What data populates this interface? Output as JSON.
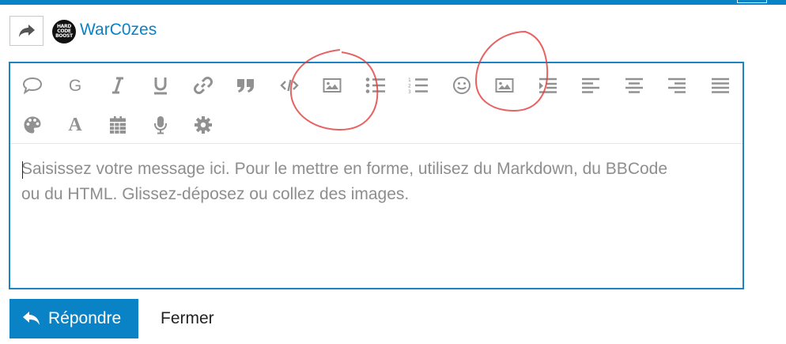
{
  "user": {
    "name": "WarC0zes",
    "avatar_lines": [
      "HARD",
      "CODE",
      "BOOST"
    ]
  },
  "toolbar": {
    "row1": [
      {
        "name": "speech-bubble-icon"
      },
      {
        "name": "google-g-icon",
        "text": "G"
      },
      {
        "name": "italic-icon"
      },
      {
        "name": "underline-icon"
      },
      {
        "name": "link-icon"
      },
      {
        "name": "quote-icon"
      },
      {
        "name": "code-icon"
      },
      {
        "name": "image-icon"
      },
      {
        "name": "bullet-list-icon"
      },
      {
        "name": "numbered-list-icon"
      },
      {
        "name": "smiley-icon"
      },
      {
        "name": "image-icon-2"
      },
      {
        "name": "indent-icon"
      },
      {
        "name": "align-left-icon"
      },
      {
        "name": "align-center-icon"
      },
      {
        "name": "align-right-icon"
      },
      {
        "name": "align-justify-icon"
      }
    ],
    "row2": [
      {
        "name": "palette-icon"
      },
      {
        "name": "font-icon",
        "text": "A"
      },
      {
        "name": "calendar-icon"
      },
      {
        "name": "microphone-icon"
      },
      {
        "name": "gear-icon"
      }
    ]
  },
  "editor": {
    "placeholder_line1": "Saisissez votre message ici. Pour le mettre en forme, utilisez du Markdown, du BBCode",
    "placeholder_line2": "ou du HTML. Glissez-déposez ou collez des images."
  },
  "actions": {
    "reply_label": "Répondre",
    "close_label": "Fermer"
  },
  "colors": {
    "accent": "#0a82c6",
    "icon_gray": "#919191",
    "annotation_red": "#e23b3b"
  }
}
